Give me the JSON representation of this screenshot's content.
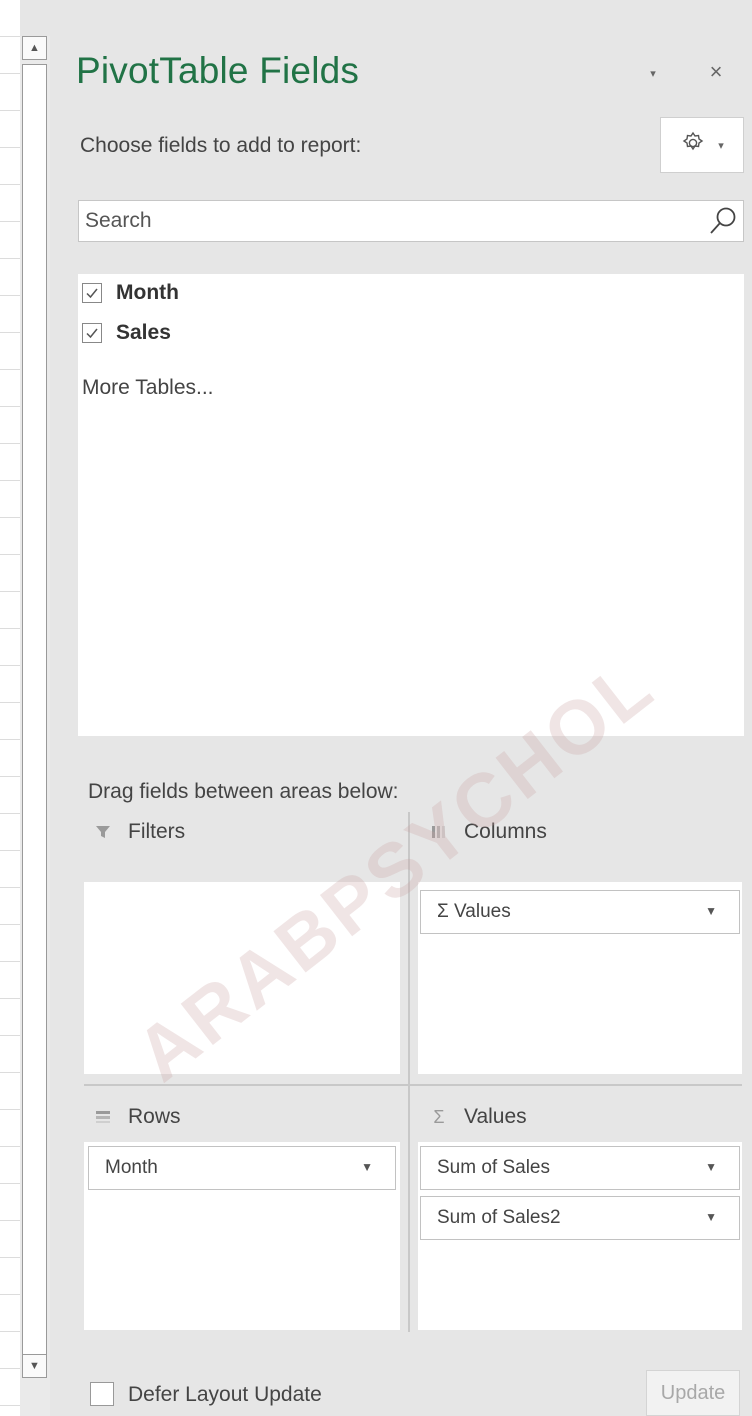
{
  "pane": {
    "title": "PivotTable Fields",
    "subtitle": "Choose fields to add to report:",
    "close_glyph": "×",
    "menu_glyph": "▾"
  },
  "search": {
    "placeholder": "Search",
    "value": ""
  },
  "fields": [
    {
      "label": "Month",
      "checked": true
    },
    {
      "label": "Sales",
      "checked": true
    }
  ],
  "more_tables": "More Tables...",
  "drag_label": "Drag fields between areas below:",
  "areas": {
    "filters": {
      "label": "Filters",
      "items": []
    },
    "columns": {
      "label": "Columns",
      "items": [
        "Σ Values"
      ]
    },
    "rows": {
      "label": "Rows",
      "items": [
        "Month"
      ]
    },
    "values": {
      "label": "Values",
      "items": [
        "Sum of Sales",
        "Sum of Sales2"
      ]
    }
  },
  "footer": {
    "defer_label": "Defer Layout Update",
    "defer_checked": false,
    "update_label": "Update"
  },
  "colors": {
    "accent": "#217346",
    "pane_bg": "#e6e6e6"
  },
  "watermark": "ARABPSYCHOL"
}
